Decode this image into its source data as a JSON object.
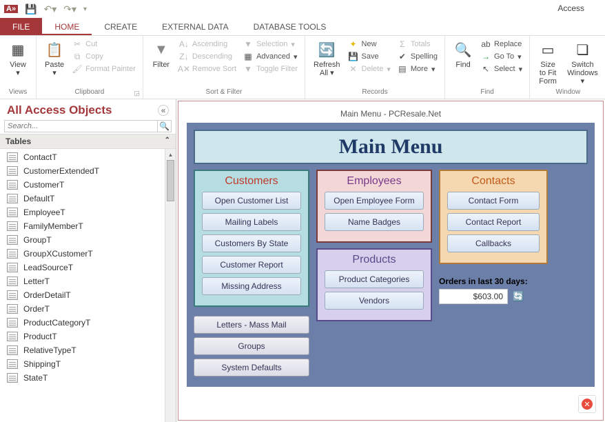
{
  "app": {
    "title": "Access"
  },
  "qat": {
    "icon1": "A",
    "save": "💾",
    "undo": "↶",
    "redo": "↷"
  },
  "tabs": {
    "file": "FILE",
    "home": "HOME",
    "create": "CREATE",
    "external": "EXTERNAL DATA",
    "dbtools": "DATABASE TOOLS"
  },
  "ribbon": {
    "views": {
      "view": "View",
      "label": "Views"
    },
    "clipboard": {
      "paste": "Paste",
      "cut": "Cut",
      "copy": "Copy",
      "fmtpainter": "Format Painter",
      "label": "Clipboard"
    },
    "sortfilter": {
      "filter": "Filter",
      "asc": "Ascending",
      "desc": "Descending",
      "remove": "Remove Sort",
      "selection": "Selection",
      "advanced": "Advanced",
      "toggle": "Toggle Filter",
      "label": "Sort & Filter"
    },
    "records": {
      "refresh": "Refresh All",
      "new": "New",
      "save": "Save",
      "delete": "Delete",
      "totals": "Totals",
      "spelling": "Spelling",
      "more": "More",
      "label": "Records"
    },
    "find": {
      "find": "Find",
      "replace": "Replace",
      "goto": "Go To",
      "select": "Select",
      "label": "Find"
    },
    "window": {
      "size": "Size to Fit Form",
      "switch": "Switch Windows",
      "label": "Window"
    }
  },
  "nav": {
    "title": "All Access Objects",
    "search_placeholder": "Search...",
    "section": "Tables",
    "items": [
      "ContactT",
      "CustomerExtendedT",
      "CustomerT",
      "DefaultT",
      "EmployeeT",
      "FamilyMemberT",
      "GroupT",
      "GroupXCustomerT",
      "LeadSourceT",
      "LetterT",
      "OrderDetailT",
      "OrderT",
      "ProductCategoryT",
      "ProductT",
      "RelativeTypeT",
      "ShippingT",
      "StateT"
    ]
  },
  "form": {
    "caption": "Main Menu - PCResale.Net",
    "heading": "Main Menu",
    "customers": {
      "title": "Customers",
      "buttons": [
        "Open Customer List",
        "Mailing Labels",
        "Customers By State",
        "Customer Report",
        "Missing Address"
      ]
    },
    "extra_buttons": [
      "Letters - Mass Mail",
      "Groups",
      "System Defaults"
    ],
    "employees": {
      "title": "Employees",
      "buttons": [
        "Open Employee Form",
        "Name Badges"
      ]
    },
    "products": {
      "title": "Products",
      "buttons": [
        "Product Categories",
        "Vendors"
      ]
    },
    "contacts": {
      "title": "Contacts",
      "buttons": [
        "Contact Form",
        "Contact Report",
        "Callbacks"
      ]
    },
    "orders": {
      "label": "Orders in last 30 days:",
      "value": "$603.00"
    }
  }
}
